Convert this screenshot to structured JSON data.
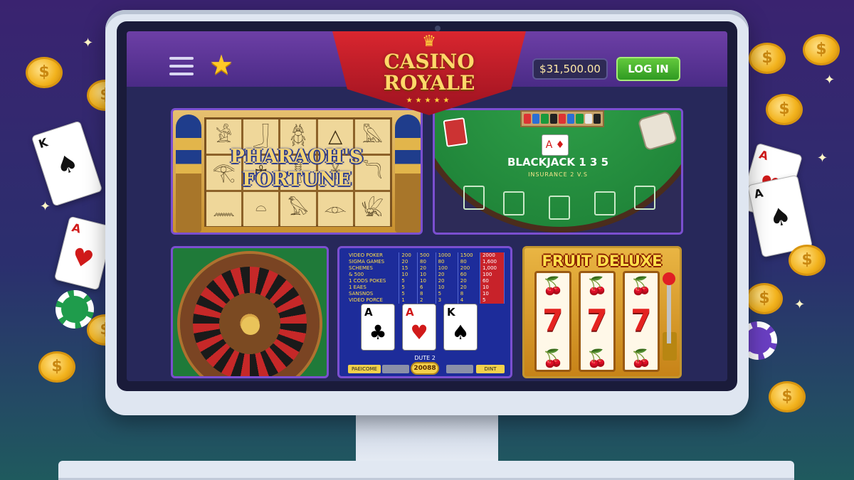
{
  "header": {
    "logo_line1": "CASINO",
    "logo_line2": "ROYALE",
    "balance": "$31,500.00",
    "login_label": "LOG IN",
    "menu_icon": "hamburger-menu-icon",
    "favorite_icon": "star-icon"
  },
  "games": {
    "pharaoh": {
      "title_line1": "PHARAOH'S",
      "title_line2": "FORTUNE"
    },
    "blackjack": {
      "title": "BLACKJACK 1 3 5",
      "subtitle": "INSURANCE 2 V.S"
    },
    "roulette": {
      "icon": "roulette-wheel-icon"
    },
    "video_poker": {
      "paytable": [
        [
          "VIDEO POKER",
          "200",
          "500",
          "1000",
          "1500",
          "2000"
        ],
        [
          "SIGMA GAMES",
          "20",
          "80",
          "80",
          "80",
          "1,600"
        ],
        [
          "SCHEMES",
          "15",
          "20",
          "100",
          "200",
          "1,000"
        ],
        [
          "& 500",
          "10",
          "10",
          "20",
          "60",
          "100"
        ],
        [
          "1 CODS POKES",
          "5",
          "10",
          "20",
          "20",
          "60"
        ],
        [
          "1 EAES",
          "5",
          "6",
          "10",
          "20",
          "10"
        ],
        [
          "SANSNOS",
          "5",
          "8",
          "5",
          "8",
          "10"
        ],
        [
          "VIDEO PORCE",
          "1",
          "2",
          "3",
          "4",
          "5"
        ]
      ],
      "cards": [
        {
          "rank": "A",
          "suit": "♣",
          "color": "#111111"
        },
        {
          "rank": "A",
          "suit": "♥",
          "color": "#d11a1a"
        },
        {
          "rank": "K",
          "suit": "♠",
          "color": "#111111"
        }
      ],
      "deal_label": "DUTE 2",
      "left_button": "PAEICOME",
      "credit": "20088",
      "right_button": "DINT"
    },
    "fruit": {
      "title": "FRUIT DELUXE"
    }
  },
  "colors": {
    "accent_purple": "#7b4fd0",
    "login_green": "#2f9a22",
    "gold": "#f2b21c",
    "logo_red": "#d9262f"
  }
}
